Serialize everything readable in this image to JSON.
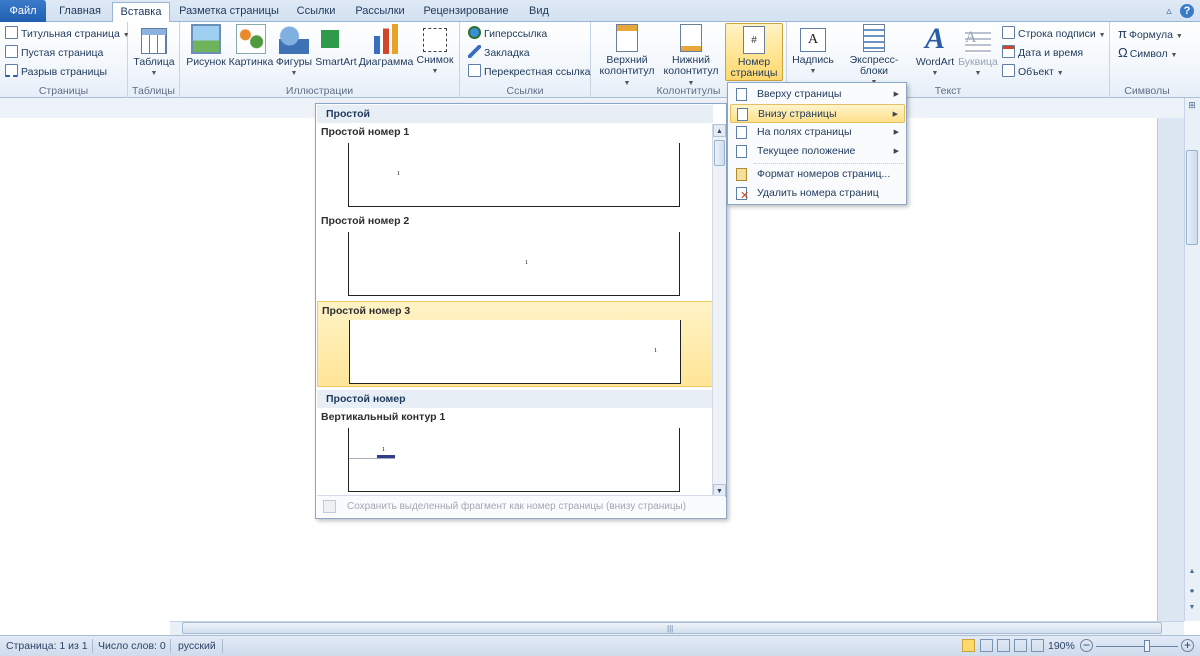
{
  "tabs": {
    "file": "Файл",
    "home": "Главная",
    "insert": "Вставка",
    "layout": "Разметка страницы",
    "references": "Ссылки",
    "mailings": "Рассылки",
    "review": "Рецензирование",
    "view": "Вид"
  },
  "ribbon": {
    "pages": {
      "label": "Страницы",
      "cover": "Титульная страница",
      "blank": "Пустая страница",
      "break": "Разрыв страницы"
    },
    "tables": {
      "label": "Таблицы",
      "table": "Таблица"
    },
    "illustrations": {
      "label": "Иллюстрации",
      "picture": "Рисунок",
      "clipart": "Картинка",
      "shapes": "Фигуры",
      "smartart": "SmartArt",
      "chart": "Диаграмма",
      "screenshot": "Снимок"
    },
    "links": {
      "label": "Ссылки",
      "hyperlink": "Гиперссылка",
      "bookmark": "Закладка",
      "crossref": "Перекрестная ссылка"
    },
    "headers": {
      "label": "Колонтитулы",
      "header_1": "Верхний",
      "header_2": "колонтитул",
      "footer_1": "Нижний",
      "footer_2": "колонтитул",
      "pagenum_1": "Номер",
      "pagenum_2": "страницы"
    },
    "text": {
      "label": "Текст",
      "textbox": "Надпись",
      "quickparts": "Экспресс-блоки",
      "wordart": "WordArt",
      "dropcap": "Буквица",
      "signature": "Строка подписи",
      "datetime": "Дата и время",
      "object": "Объект"
    },
    "symbols": {
      "label": "Символы",
      "equation": "Формула",
      "symbol": "Символ"
    }
  },
  "gallery": {
    "section1": "Простой",
    "item1": "Простой номер 1",
    "item2": "Простой номер 2",
    "item3": "Простой номер 3",
    "section2": "Простой номер",
    "item4": "Вертикальный контур 1",
    "page_number": "1",
    "footer": "Сохранить выделенный фрагмент как номер страницы (внизу страницы)"
  },
  "menu": {
    "top": "Вверху страницы",
    "bottom": "Внизу страницы",
    "margins": "На полях страницы",
    "current": "Текущее положение",
    "format": "Формат номеров страниц...",
    "remove": "Удалить номера страниц"
  },
  "status": {
    "page": "Страница: 1 из 1",
    "words": "Число слов: 0",
    "language": "русский",
    "zoom": "190%"
  },
  "colors": {
    "accent": "#2a5ea8",
    "highlight": "#ffe597",
    "ribbon_bg": "#f4f8fc"
  }
}
